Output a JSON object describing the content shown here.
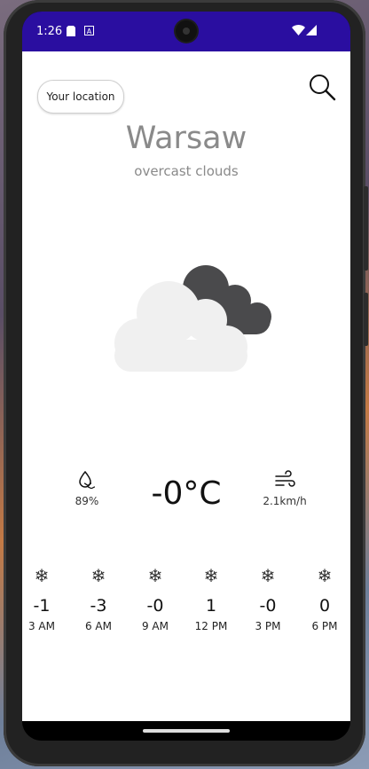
{
  "status_bar": {
    "time": "1:26",
    "icons": [
      "sd-card-icon",
      "a-icon",
      "wifi-icon",
      "signal-icon"
    ]
  },
  "header": {
    "location_button": "Your location",
    "search_icon": "search-icon"
  },
  "weather": {
    "city": "Warsaw",
    "description": "overcast clouds",
    "icon": "overcast-clouds-icon",
    "temperature": "-0°C",
    "humidity": "89%",
    "wind": "2.1km/h"
  },
  "hourly": [
    {
      "icon": "snowflake-icon",
      "temp": "-1",
      "time": "3 AM"
    },
    {
      "icon": "snowflake-icon",
      "temp": "-3",
      "time": "6 AM"
    },
    {
      "icon": "snowflake-icon",
      "temp": "-0",
      "time": "9 AM"
    },
    {
      "icon": "snowflake-icon",
      "temp": "1",
      "time": "12 PM"
    },
    {
      "icon": "snowflake-icon",
      "temp": "-0",
      "time": "3 PM"
    },
    {
      "icon": "snowflake-icon",
      "temp": "0",
      "time": "6 PM"
    }
  ],
  "colors": {
    "status_bar": "#2a0ea0",
    "text_muted": "#8a8a8a",
    "cloud_light": "#f0f0f0",
    "cloud_dark": "#4a4a4c"
  }
}
